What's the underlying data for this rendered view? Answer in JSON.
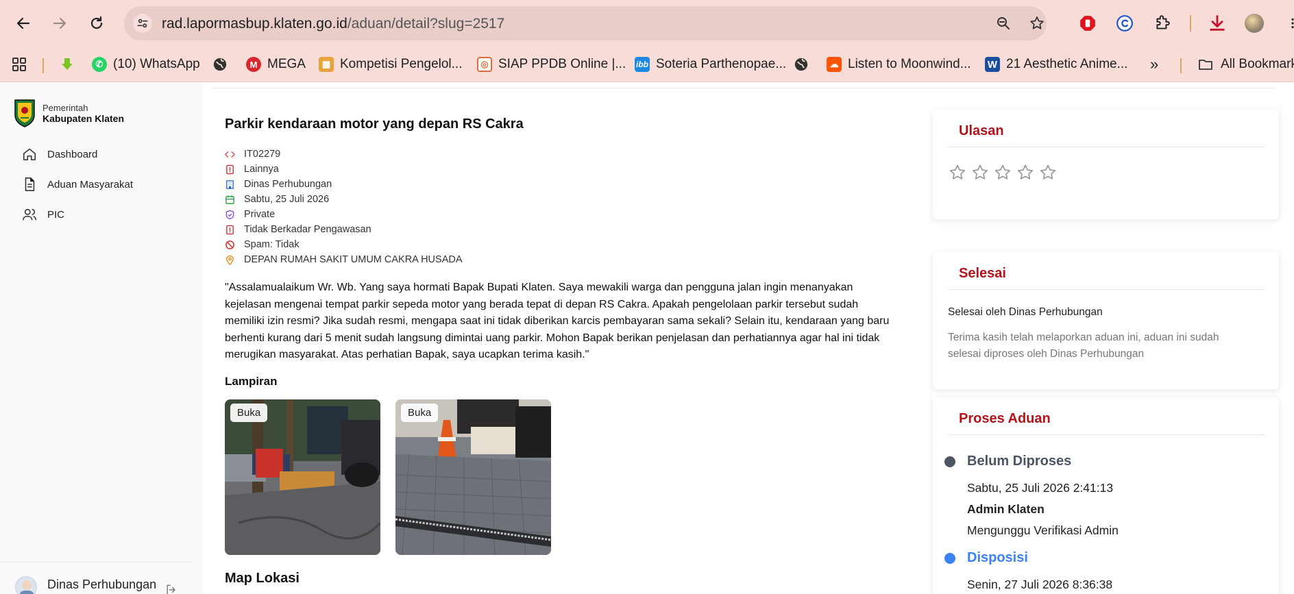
{
  "browser": {
    "url_host": "rad.lapormasbup.klaten.go.id",
    "url_path": "/aduan/detail?slug=2517",
    "icons": [
      "back-icon",
      "forward-icon",
      "reload-icon",
      "site-settings-icon",
      "zoom-icon",
      "bookmark-star-icon",
      "extensions-icon",
      "download-icon"
    ],
    "bookmarks": [
      {
        "label": "(10) WhatsApp",
        "color": "#25d366"
      },
      {
        "label": "MEGA",
        "color": "#d9272e"
      },
      {
        "label": "Kompetisi Pengelol...",
        "color": "#e8a33c"
      },
      {
        "label": "SIAP PPDB Online |...",
        "color": "#e06c3c"
      },
      {
        "label": "Soteria Parthenopae...",
        "color": "#1e88e5"
      },
      {
        "label": "Listen to Moonwind...",
        "color": "#ff5500"
      },
      {
        "label": "21 Aesthetic Anime...",
        "color": "#1a4fa0"
      }
    ],
    "all_bookmarks": "All Bookmark"
  },
  "sidebar": {
    "brand_line1": "Pemerintah",
    "brand_line2": "Kabupaten Klaten",
    "nav": [
      {
        "label": "Dashboard",
        "icon": "home-icon"
      },
      {
        "label": "Aduan Masyarakat",
        "icon": "document-icon"
      },
      {
        "label": "PIC",
        "icon": "users-icon"
      }
    ],
    "user_name": "Dinas Perhubungan"
  },
  "complaint": {
    "title": "Parkir kendaraan motor yang depan RS Cakra",
    "code": "IT02279",
    "category": "Lainnya",
    "agency": "Dinas Perhubungan",
    "date": "Sabtu, 25 Juli 2026",
    "visibility": "Private",
    "supervision": "Tidak Berkadar Pengawasan",
    "spam": "Spam: Tidak",
    "location": "DEPAN RUMAH SAKIT UMUM CAKRA HUSADA",
    "description": "\"Assalamualaikum Wr. Wb. Yang saya hormati Bapak Bupati Klaten. Saya mewakili warga dan pengguna jalan ingin menanyakan kejelasan mengenai tempat parkir sepeda motor yang berada tepat di depan RS Cakra. Apakah pengelolaan parkir tersebut sudah memiliki izin resmi? Jika sudah resmi, mengapa saat ini tidak diberikan karcis pembayaran sama sekali? Selain itu, kendaraan yang baru berhenti kurang dari 5 menit sudah langsung dimintai uang parkir. Mohon Bapak berikan penjelasan dan perhatiannya agar hal ini tidak merugikan masyarakat. Atas perhatian Bapak, saya ucapkan terima kasih.\"",
    "attachments_title": "Lampiran",
    "open_label": "Buka",
    "map_title": "Map Lokasi"
  },
  "review": {
    "title": "Ulasan",
    "rating": 0,
    "max": 5
  },
  "finished": {
    "title": "Selesai",
    "by": "Selesai oleh Dinas Perhubungan",
    "message": "Terima kasih telah melaporkan aduan ini, aduan ini sudah selesai diproses oleh Dinas Perhubungan"
  },
  "process": {
    "title": "Proses Aduan",
    "steps": [
      {
        "status": "Belum Diproses",
        "time": "Sabtu, 25 Juli 2026 2:41:13",
        "actor": "Admin Klaten",
        "note": "Mengunggu Verifikasi Admin",
        "color": "#4b5563"
      },
      {
        "status": "Disposisi",
        "time": "Senin, 27 Juli 2026 8:36:38",
        "color": "#3b82f6"
      }
    ]
  },
  "colors": {
    "accent_red": "#b5121b",
    "chrome": "#f7dcd8"
  }
}
